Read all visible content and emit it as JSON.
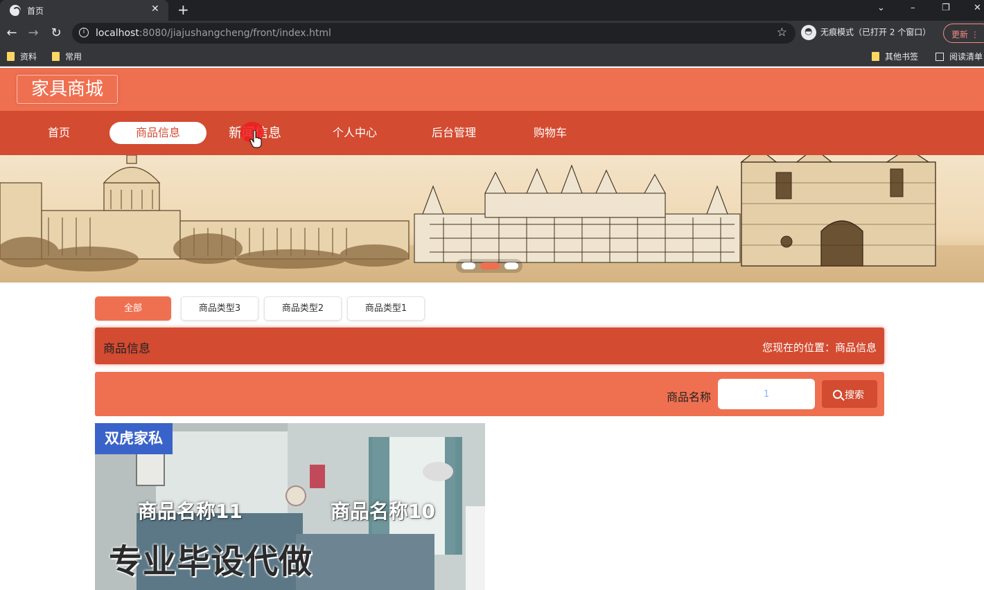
{
  "browser": {
    "tab_title": "首页",
    "tab_close": "✕",
    "new_tab": "+",
    "window_controls": [
      "⌄",
      "–",
      "❐",
      "✕"
    ],
    "url_host": "localhost",
    "url_rest": ":8080/jiajushangcheng/front/index.html",
    "star": "☆",
    "incognito_label": "无痕模式（已打开 2 个窗口）",
    "update_label": "更新 ⋮",
    "back": "←",
    "forward": "→",
    "reload": "↻",
    "bookmarks": [
      "资料",
      "常用"
    ],
    "bookmarks_right": [
      "其他书签",
      "阅读清单"
    ]
  },
  "site": {
    "logo": "家具商城"
  },
  "nav": {
    "items": [
      "首页",
      "商品信息",
      "新闻信息",
      "个人中心",
      "后台管理",
      "购物车"
    ],
    "active_index": 1
  },
  "carousel": {
    "slide_count": 3,
    "active_index": 1
  },
  "filters": {
    "items": [
      "全部",
      "商品类型3",
      "商品类型2",
      "商品类型1"
    ],
    "active_index": 0
  },
  "section": {
    "title": "商品信息",
    "breadcrumb": "您现在的位置：商品信息"
  },
  "search": {
    "label": "商品名称",
    "value": "1",
    "button": "搜索"
  },
  "products": {
    "brand_tag": "双虎家私",
    "names": [
      "商品名称11",
      "商品名称10"
    ],
    "watermark": "专业毕设代做"
  },
  "colors": {
    "primary": "#ef7050",
    "primary_dark": "#d34b31",
    "chrome_dark": "#202124",
    "chrome": "#35363a"
  }
}
